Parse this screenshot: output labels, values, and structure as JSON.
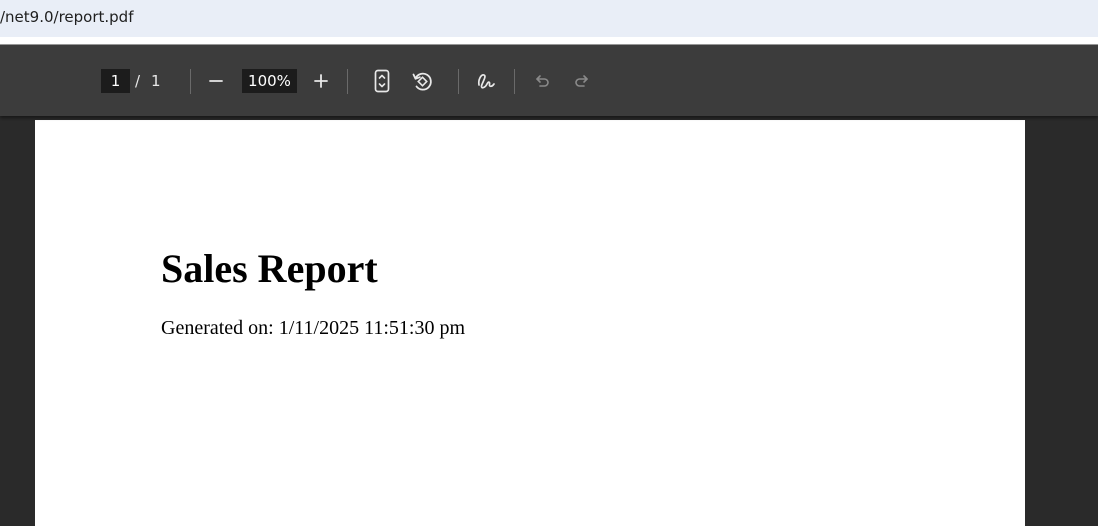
{
  "address_bar": {
    "url_text": "/net9.0/report.pdf"
  },
  "toolbar": {
    "current_page": "1",
    "page_separator": "/",
    "total_pages": "1",
    "zoom": "100%",
    "zoom_out_icon": "minus-icon",
    "zoom_in_icon": "plus-icon",
    "fit_page_icon": "fit-to-page-icon",
    "rotate_icon": "rotate-counterclockwise-icon",
    "draw_icon": "draw-signature-icon",
    "undo_icon": "undo-icon",
    "redo_icon": "redo-icon"
  },
  "document": {
    "title": "Sales Report",
    "generated": "Generated on: 1/11/2025 11:51:30 pm"
  },
  "colors": {
    "toolbar_bg": "#3c3c3c",
    "viewer_bg": "#2a2a2a",
    "address_bar_bg": "#e9eef7",
    "page_bg": "#ffffff",
    "disabled_icon": "#8a8a8a"
  }
}
